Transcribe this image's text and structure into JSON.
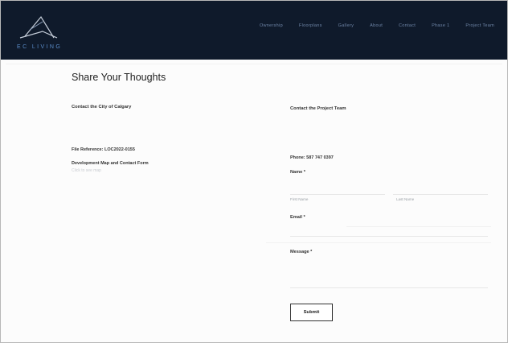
{
  "header": {
    "brand": "EC LIVING",
    "logo_icon": "ec-living-logo-icon",
    "nav": [
      "Ownership",
      "Floorplans",
      "Gallery",
      "About",
      "Contact",
      "Phase 1",
      "Project Team"
    ]
  },
  "page": {
    "title": "Share Your Thoughts"
  },
  "left": {
    "heading": "Contact the City of Calgary",
    "file_reference": "File Reference: LOC2022-0155",
    "development_map": "Development Map and Contact Form",
    "map_link": "Click to see map"
  },
  "right": {
    "heading": "Contact the Project Team",
    "phone": "Phone: 587 747 0397",
    "form": {
      "name_label": "Name *",
      "first_name": "First Name",
      "last_name": "Last Name",
      "email_label": "Email *",
      "message_label": "Message *",
      "submit_label": "Submit"
    }
  },
  "colors": {
    "header_bg": "#0f1a2b",
    "brand_accent": "#5b8cc8"
  }
}
